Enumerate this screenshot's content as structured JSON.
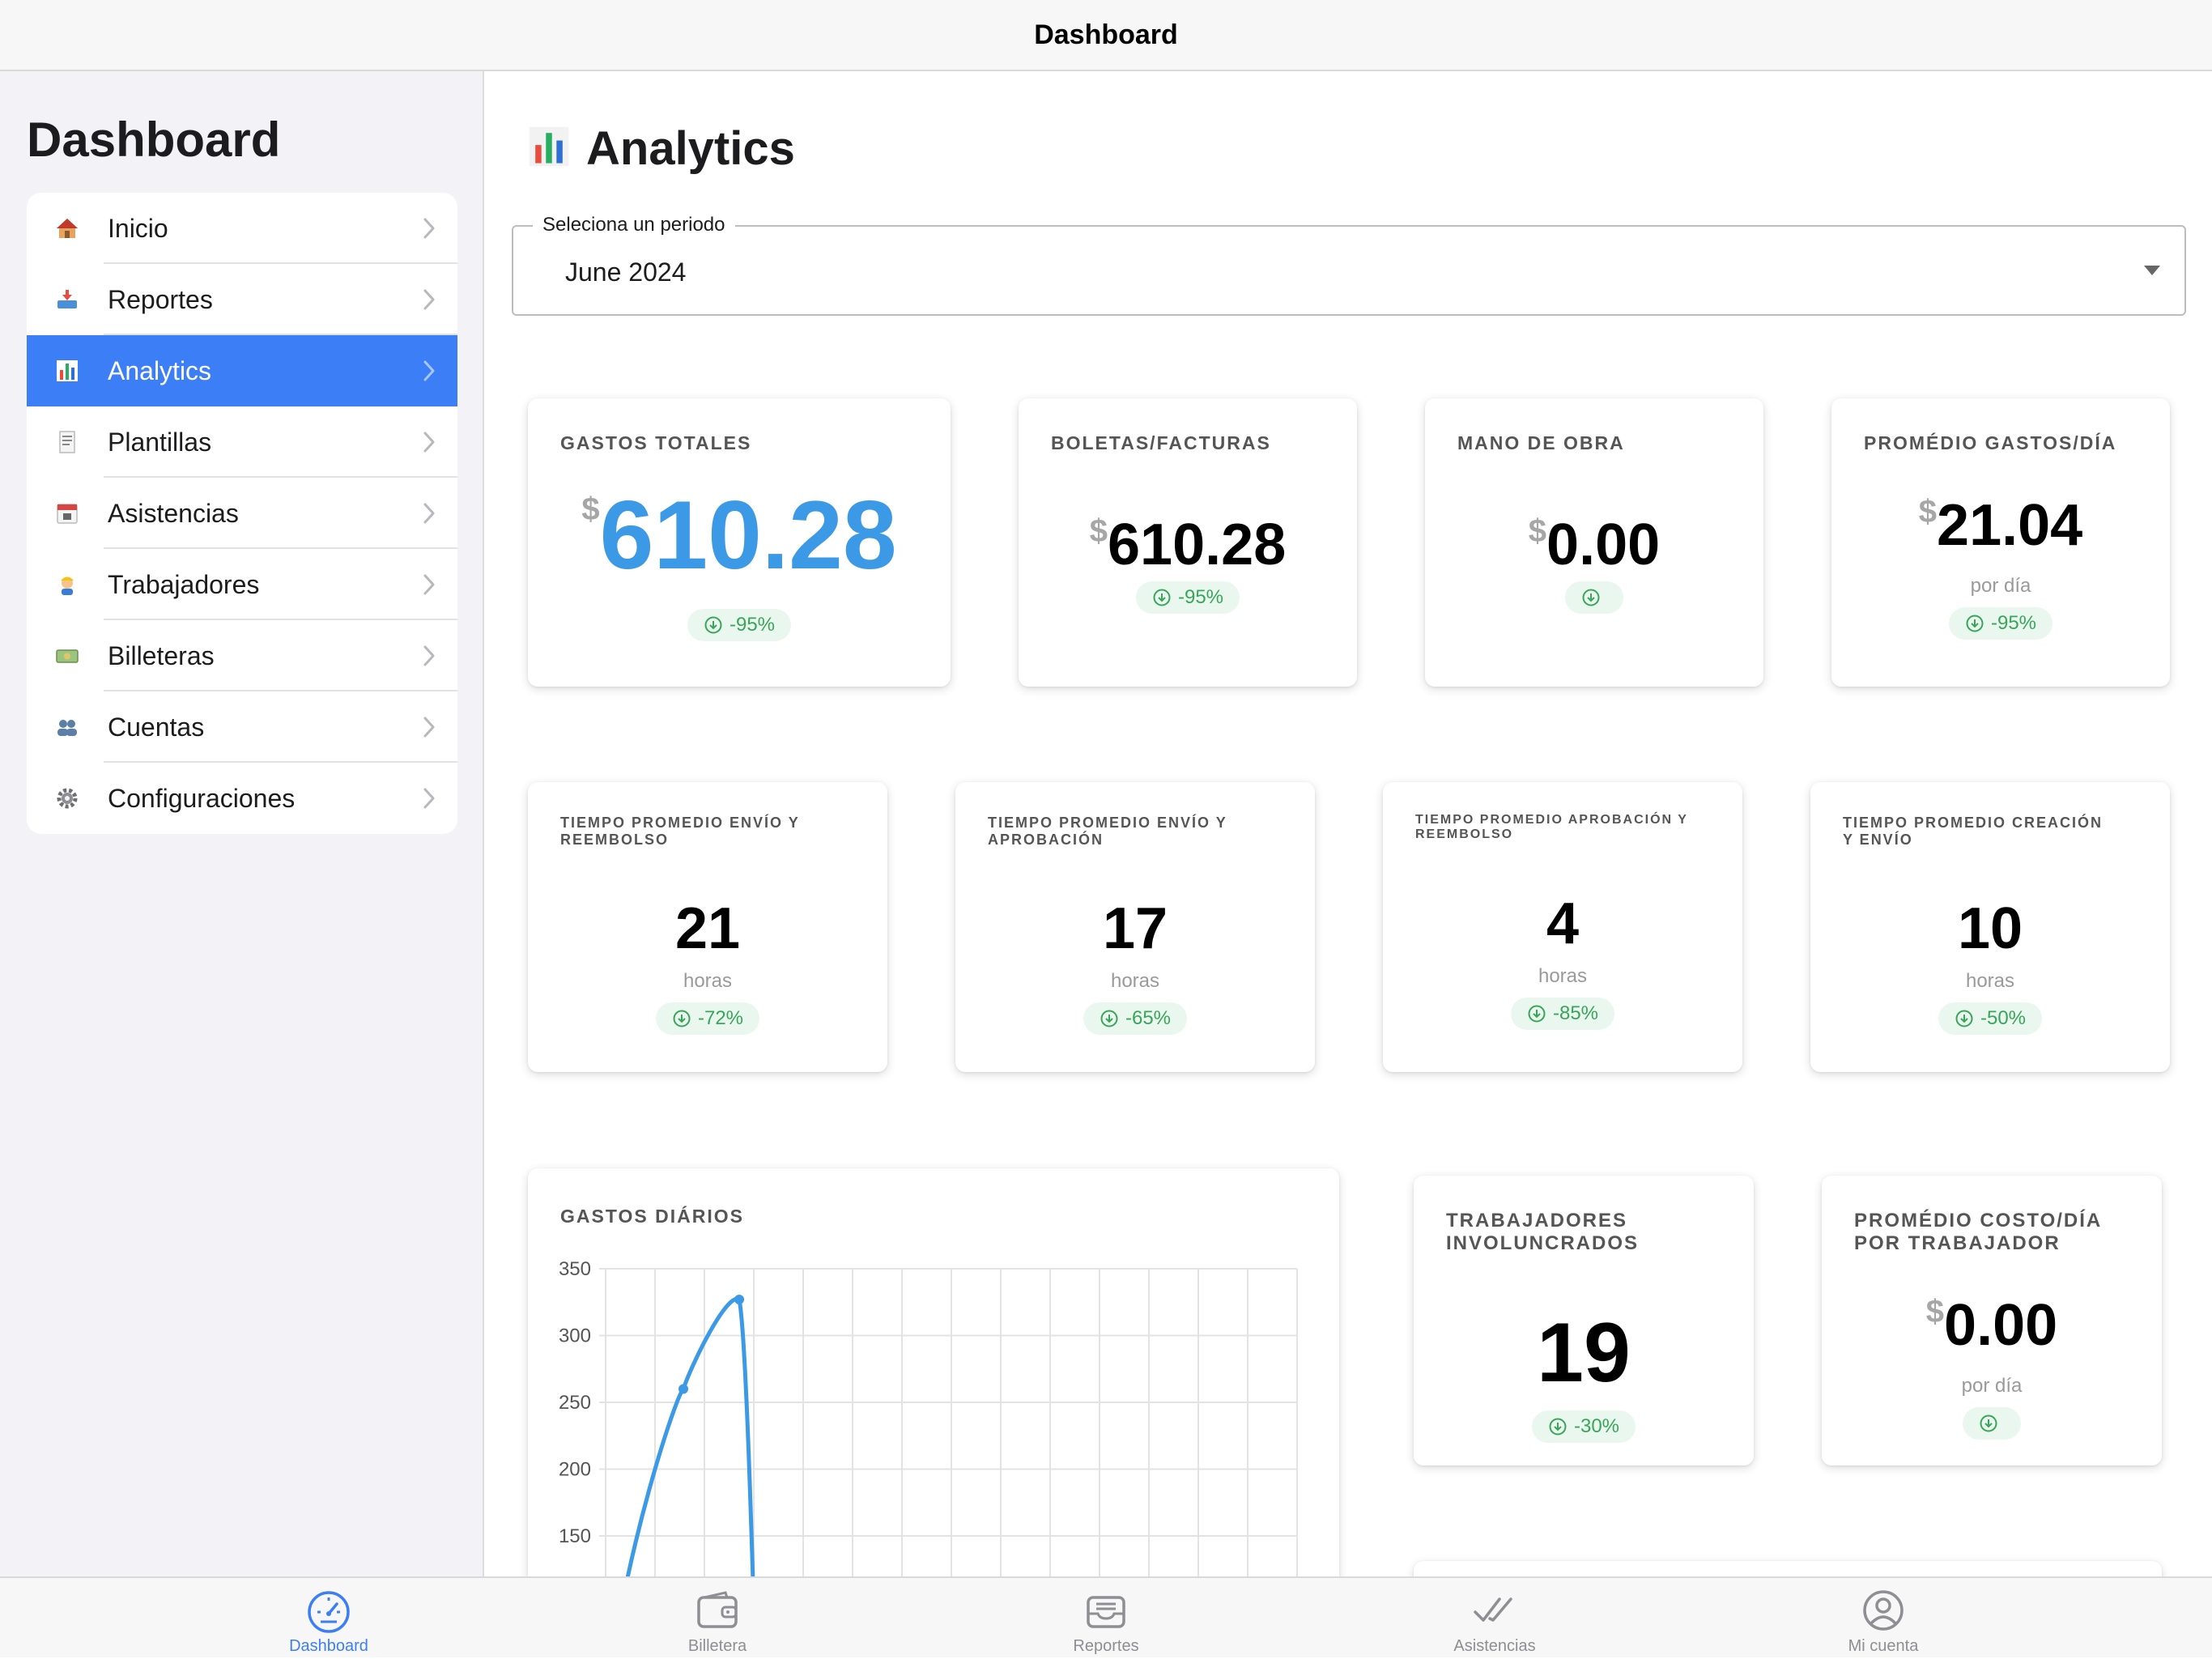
{
  "topbar": {
    "title": "Dashboard"
  },
  "sidebar": {
    "title": "Dashboard",
    "items": [
      {
        "label": "Inicio",
        "icon": "house-icon"
      },
      {
        "label": "Reportes",
        "icon": "inbox-tray-icon"
      },
      {
        "label": "Analytics",
        "icon": "bar-chart-icon",
        "active": true
      },
      {
        "label": "Plantillas",
        "icon": "receipt-icon"
      },
      {
        "label": "Asistencias",
        "icon": "calendar-icon"
      },
      {
        "label": "Trabajadores",
        "icon": "worker-icon"
      },
      {
        "label": "Billeteras",
        "icon": "money-icon"
      },
      {
        "label": "Cuentas",
        "icon": "people-icon"
      },
      {
        "label": "Configuraciones",
        "icon": "gear-icon"
      }
    ]
  },
  "page": {
    "title": "Analytics"
  },
  "period_select": {
    "legend": "Seleciona un periodo",
    "value": "June 2024"
  },
  "currency_symbol": "$",
  "cards_row1": [
    {
      "label": "GASTOS TOTALES",
      "value": "610.28",
      "change": "-95%"
    },
    {
      "label": "BOLETAS/FACTURAS",
      "value": "610.28",
      "change": "-95%"
    },
    {
      "label": "MANO DE OBRA",
      "value": "0.00",
      "change": ""
    },
    {
      "label": "PROMÉDIO GASTOS/DÍA",
      "value": "21.04",
      "unit": "por día",
      "change": "-95%"
    }
  ],
  "cards_row2": [
    {
      "label": "TIEMPO PROMEDIO ENVÍO Y REEMBOLSO",
      "value": "21",
      "unit": "horas",
      "change": "-72%"
    },
    {
      "label": "TIEMPO PROMEDIO ENVÍO Y APROBACIÓN",
      "value": "17",
      "unit": "horas",
      "change": "-65%"
    },
    {
      "label": "TIEMPO PROMEDIO APROBACIÓN Y REEMBOLSO",
      "value": "4",
      "unit": "horas",
      "change": "-85%"
    },
    {
      "label": "TIEMPO PROMEDIO CREACIÓN Y ENVÍO",
      "value": "10",
      "unit": "horas",
      "change": "-50%"
    }
  ],
  "cards_row3": [
    {
      "label": "TRABAJADORES INVOLUNCRADOS",
      "value": "19",
      "change": "-30%"
    },
    {
      "label": "PROMÉDIO COSTO/DÍA POR TRABAJADOR",
      "value": "0.00",
      "unit": "por día",
      "change": ""
    }
  ],
  "chart_data": {
    "type": "line",
    "title": "GASTOS DIÁRIOS",
    "xlabel": "",
    "ylabel": "",
    "y_ticks": [
      350,
      300,
      250,
      200,
      150
    ],
    "ylim_visible": [
      125,
      350
    ],
    "x": [
      1,
      2,
      3,
      4
    ],
    "values": [
      0,
      260,
      327,
      0
    ],
    "grid": true,
    "color": "#3b99e6"
  },
  "tabbar": {
    "tabs": [
      {
        "label": "Dashboard",
        "icon": "speedometer-icon",
        "active": true
      },
      {
        "label": "Billetera",
        "icon": "wallet-icon"
      },
      {
        "label": "Reportes",
        "icon": "tray-icon"
      },
      {
        "label": "Asistencias",
        "icon": "double-check-icon"
      },
      {
        "label": "Mi cuenta",
        "icon": "person-circle-icon"
      }
    ]
  },
  "colors": {
    "accent": "#3c7ef6",
    "highlight_value": "#3b99e6",
    "positive": "#39a55a"
  }
}
